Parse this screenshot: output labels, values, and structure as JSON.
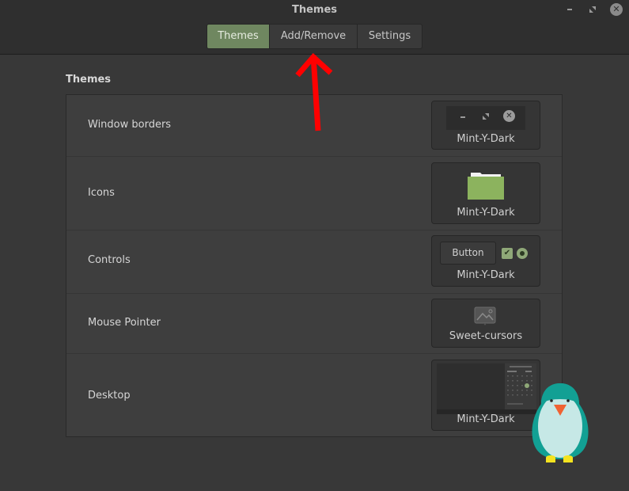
{
  "window": {
    "title": "Themes",
    "controls": {
      "minimize_icon": "minimize-icon",
      "maximize_icon": "maximize-icon",
      "close_icon": "close-icon"
    }
  },
  "tabs": [
    {
      "label": "Themes",
      "active": true
    },
    {
      "label": "Add/Remove",
      "active": false
    },
    {
      "label": "Settings",
      "active": false
    }
  ],
  "section": {
    "title": "Themes"
  },
  "rows": [
    {
      "label": "Window borders",
      "value": "Mint-Y-Dark",
      "preview": "window-buttons"
    },
    {
      "label": "Icons",
      "value": "Mint-Y-Dark",
      "preview": "folder-icon"
    },
    {
      "label": "Controls",
      "value": "Mint-Y-Dark",
      "preview": "controls",
      "button_label": "Button"
    },
    {
      "label": "Mouse Pointer",
      "value": "Sweet-cursors",
      "preview": "image-missing-icon"
    },
    {
      "label": "Desktop",
      "value": "Mint-Y-Dark",
      "preview": "desktop-thumbnail"
    }
  ],
  "annotation": {
    "type": "red-arrow",
    "points_to": "Add/Remove",
    "color": "#ff0000"
  },
  "colors": {
    "accent": "#6f8760",
    "folder": "#8cb35e",
    "check": "#8fa878",
    "penguin_body": "#12a094",
    "penguin_belly": "#c6e8e6",
    "penguin_beak": "#f06232",
    "penguin_feet": "#f5e31f"
  }
}
